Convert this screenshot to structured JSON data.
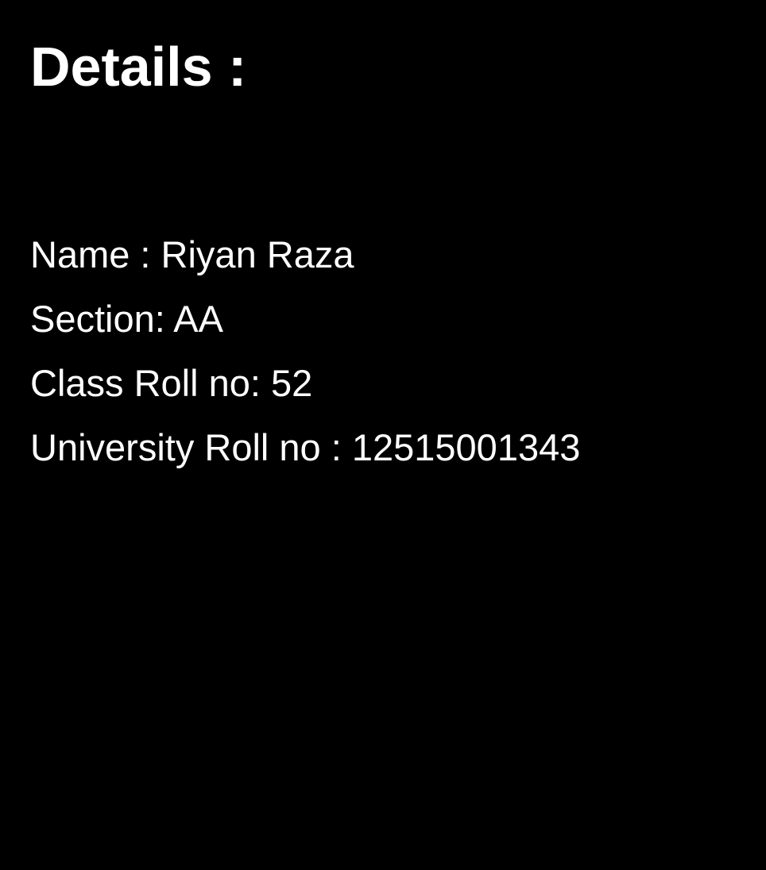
{
  "page": {
    "background_color": "#000000",
    "text_color": "#ffffff",
    "title": "Details :"
  },
  "details": [
    {
      "text": "Name : Riyan Raza"
    },
    {
      "text": "Section: AA"
    },
    {
      "text": "Class Roll no: 52"
    },
    {
      "text": "University Roll no : 12515001343"
    }
  ]
}
